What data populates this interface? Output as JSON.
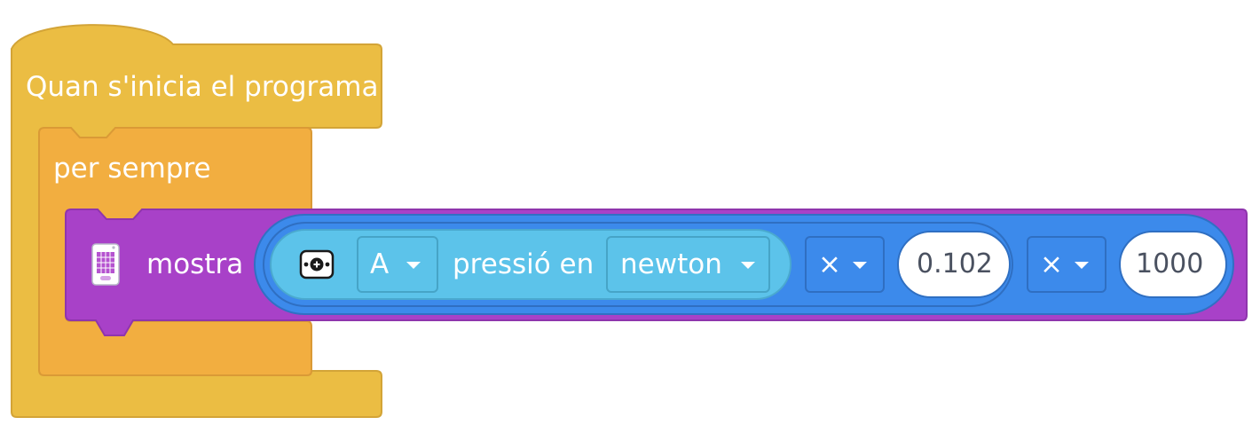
{
  "hat_block": {
    "label": "Quan s'inicia el programa"
  },
  "forever_block": {
    "label": "per sempre"
  },
  "display_block": {
    "label": "mostra"
  },
  "force_sensor": {
    "port": "A",
    "label": "pressió en",
    "unit": "newton"
  },
  "operators": [
    {
      "symbol": "×",
      "value": "0.102"
    },
    {
      "symbol": "×",
      "value": "1000"
    }
  ],
  "colors": {
    "event": "#ebbd43",
    "control": "#f2ae40",
    "display": "#a841c8",
    "operator": "#3c8aeb",
    "sensor": "#5cc3ea"
  }
}
